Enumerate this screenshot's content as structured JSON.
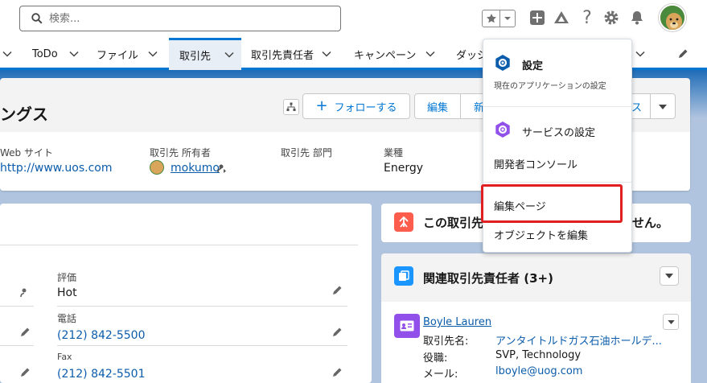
{
  "search": {
    "placeholder": "検索..."
  },
  "nav": {
    "tabs": [
      {
        "label": "ToDo"
      },
      {
        "label": "ファイル"
      },
      {
        "label": "取引先"
      },
      {
        "label": "取引先責任者"
      },
      {
        "label": "キャンペーン"
      },
      {
        "label": "ダッシ"
      }
    ]
  },
  "header": {
    "title": "ングス",
    "follow_label": "フォローする",
    "edit_label": "編集",
    "new_label": "新",
    "other_label": "ス"
  },
  "fields": [
    {
      "label": "Web サイト",
      "value": "http://www.uos.com"
    },
    {
      "label": "取引先 所有者",
      "value": "mokumo"
    },
    {
      "label": "取引先 部門",
      "value": ""
    },
    {
      "label": "業種",
      "value": "Energy"
    }
  ],
  "detail": {
    "rating_label": "評価",
    "rating_value": "Hot",
    "phone_label": "電話",
    "phone_value": "(212) 842-5500",
    "fax_label": "Fax",
    "fax_value": "(212) 842-5501"
  },
  "card1": {
    "title": "この取引先",
    "title_suffix": "せん。"
  },
  "card2": {
    "title": "関連取引先責任者 (3+)",
    "contact_name": "Boyle Lauren",
    "account_label": "取引先名:",
    "account_value": "アンタイトルドガス石油ホールデ...",
    "title_label": "役職:",
    "title_value": "SVP, Technology",
    "email_label": "メール:",
    "email_value": "lboyle@uog.com"
  },
  "menu": {
    "settings": "設定",
    "settings_sub": "現在のアプリケーションの設定",
    "service_settings": "サービスの設定",
    "developer_console": "開発者コンソール",
    "edit_page": "編集ページ",
    "edit_object": "オブジェクトを編集"
  },
  "colors": {
    "accent": "#0176d3",
    "highlight": "#e02020",
    "gear": "#0b5cab",
    "service": "#9050e9",
    "contact_icon": "#9050e9",
    "card_icon": "#1b96ff",
    "alert_icon": "#fe5c4c"
  },
  "icons": [
    "search-icon",
    "star-icon",
    "chevron-down-icon",
    "plus-icon",
    "trailhead-icon",
    "help-icon",
    "gear-icon",
    "bell-icon",
    "pencil-icon"
  ]
}
